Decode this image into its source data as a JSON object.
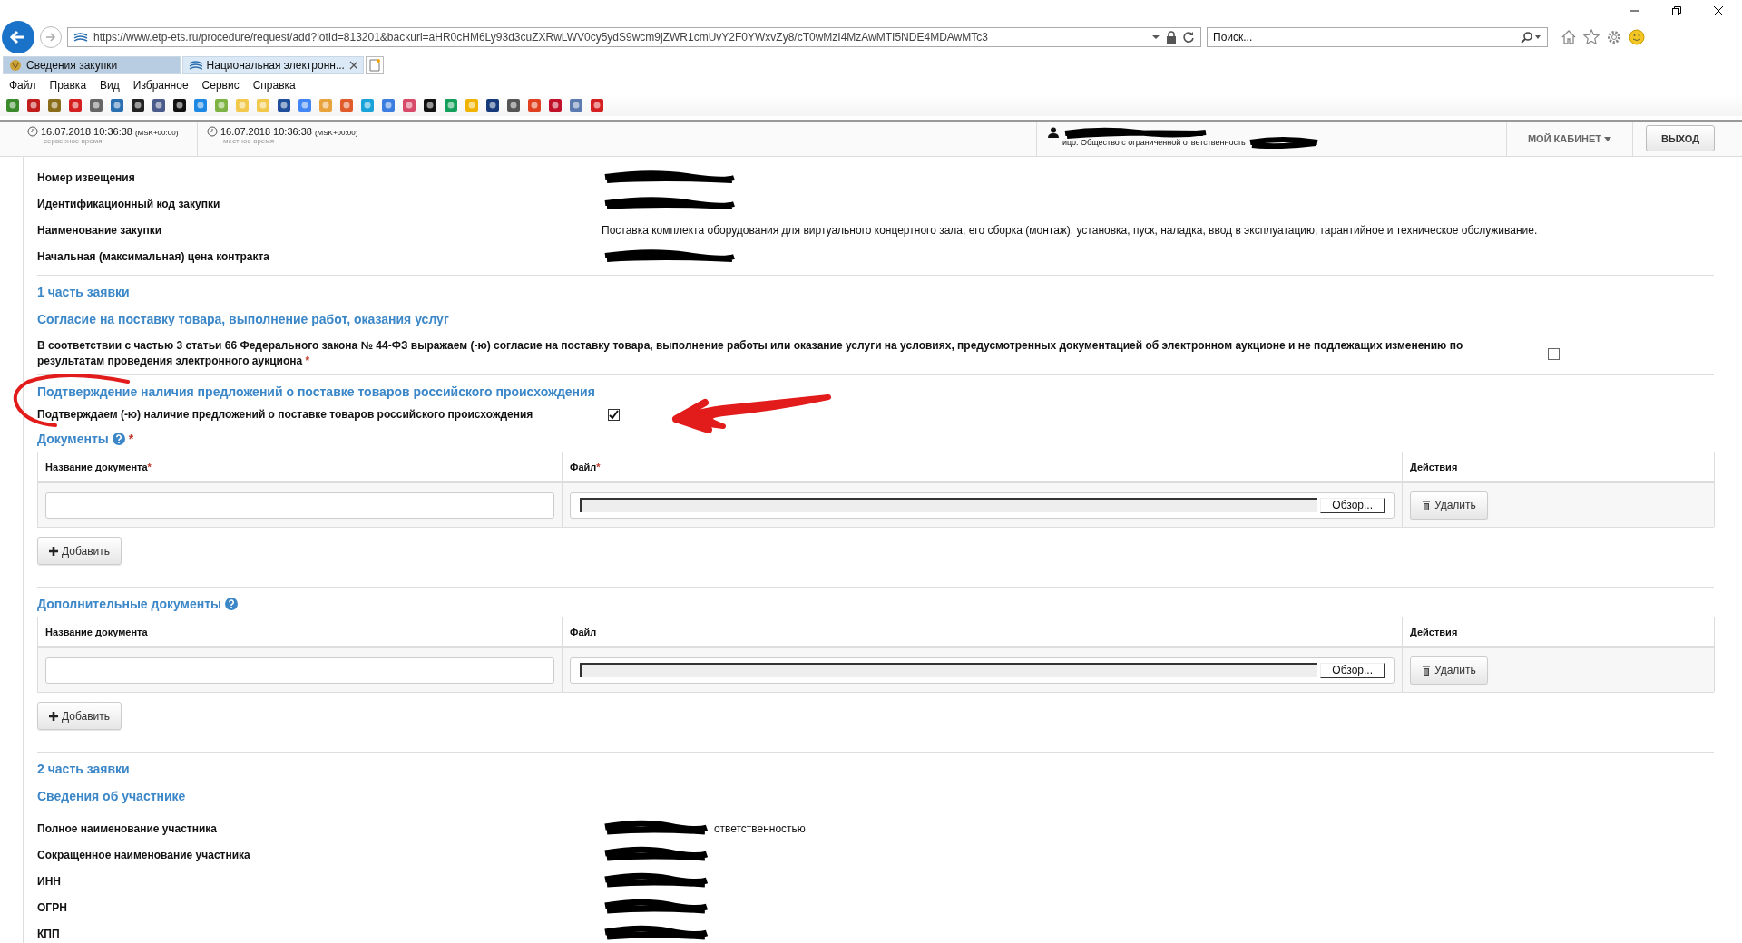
{
  "browser": {
    "address": "https://www.etp-ets.ru/procedure/request/add?lotId=813201&backurl=aHR0cHM6Ly93d3cuZXRwLWV0cy5ydS9wcm9jZWR1cmUvY2F0YWxvZy8/cT0wMzI4MzAwMTI5NDE4MDAwMTc3",
    "search_placeholder": "Поиск...",
    "tabs": [
      {
        "label": "Сведения закупки",
        "selected": false
      },
      {
        "label": "Национальная электронн...",
        "selected": true
      }
    ],
    "menu": [
      "Файл",
      "Правка",
      "Вид",
      "Избранное",
      "Сервис",
      "Справка"
    ]
  },
  "header": {
    "times": [
      {
        "value": "16.07.2018 10:36:38",
        "zone": "(MSK+00:00)",
        "caption": "серверное время"
      },
      {
        "value": "16.07.2018 10:36:38",
        "zone": "(MSK+00:00)",
        "caption": "местное время"
      }
    ],
    "user_line": "ицо: Общество с ограниченной ответственность",
    "cabinet": "МОЙ КАБИНЕТ",
    "logout": "ВЫХОД"
  },
  "procurement": [
    {
      "label": "Номер извещения",
      "redacted": true
    },
    {
      "label": "Идентификационный код закупки",
      "redacted": true
    },
    {
      "label": "Наименование закупки",
      "value": "Поставка комплекта оборудования для виртуального концертного зала, его сборка (монтаж), установка, пуск, наладка, ввод в эксплуатацию, гарантийное и техническое обслуживание.",
      "redacted": false
    },
    {
      "label": "Начальная (максимальная) цена контракта",
      "redacted": true
    }
  ],
  "part1": {
    "title": "1 часть заявки",
    "consent": {
      "title": "Согласие на поставку товара, выполнение работ, оказания услуг",
      "text": "В соответствии с частью 3 статьи 66 Федерального закона № 44-ФЗ выражаем (-ю) согласие на поставку товара, выполнение работы или оказание услуги на условиях, предусмотренных документацией об электронном аукционе и не подлежащих изменению по результатам проведения электронного аукциона",
      "required": "*",
      "checked": false
    },
    "origin": {
      "title": "Подтверждение наличия предложений о поставке товаров российского происхождения",
      "text": "Подтверждаем (-ю) наличие предложений о поставке товаров российского происхождения",
      "checked": true
    }
  },
  "documents": [
    {
      "title": "Документы",
      "required": "*",
      "columns": [
        {
          "label": "Название документа",
          "required": "*"
        },
        {
          "label": "Файл",
          "required": "*"
        },
        {
          "label": "Действия"
        }
      ],
      "browse": "Обзор...",
      "delete": "Удалить",
      "add": "Добавить"
    },
    {
      "title": "Дополнительные документы",
      "columns": [
        {
          "label": "Название документа"
        },
        {
          "label": "Файл"
        },
        {
          "label": "Действия"
        }
      ],
      "browse": "Обзор...",
      "delete": "Удалить",
      "add": "Добавить"
    }
  ],
  "part2": {
    "title": "2 часть заявки",
    "section": "Сведения об участнике",
    "rows": [
      {
        "label": "Полное наименование участника",
        "value": "ответственностью",
        "redacted": true
      },
      {
        "label": "Сокращенное наименование участника",
        "redacted": true
      },
      {
        "label": "ИНН",
        "redacted": true
      },
      {
        "label": "ОГРН",
        "redacted": true
      },
      {
        "label": "КПП",
        "redacted": true
      }
    ]
  }
}
